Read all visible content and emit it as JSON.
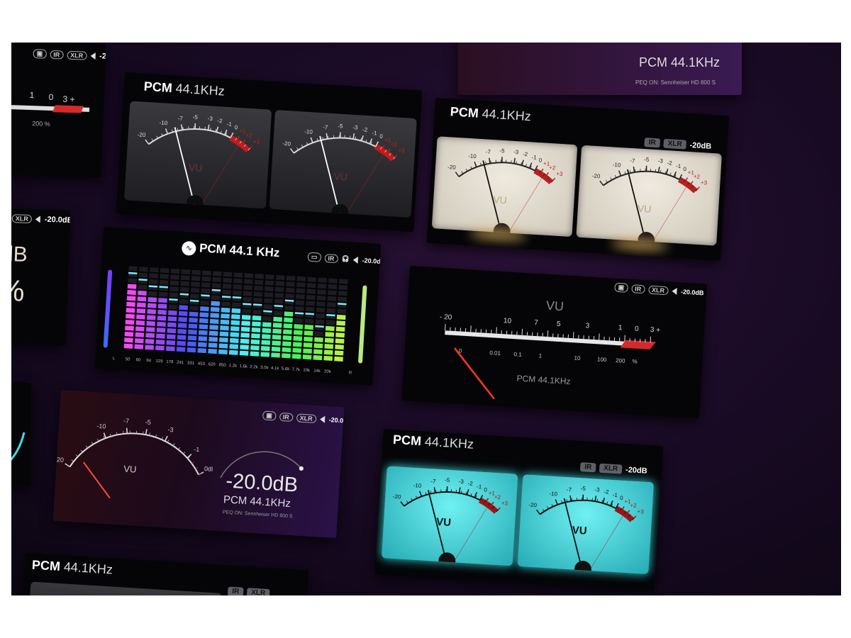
{
  "badges": {
    "ir": "IR",
    "xlr": "XLR",
    "level": "-20dB",
    "level_alt": "-20.0dB"
  },
  "format": {
    "pcm": "PCM",
    "rate": "44.1KHz",
    "rate_spaced": "44.1 KHz"
  },
  "vu": {
    "label": "VU",
    "scale": [
      "-20",
      "-10",
      "-7",
      "-5",
      "-3",
      "-2",
      "-1",
      "0",
      "+1",
      "+2",
      "+3"
    ],
    "scale_short": [
      "-20",
      "-10",
      "-7",
      "-5",
      "-3",
      "-1",
      "0dB"
    ]
  },
  "linear_meter": {
    "top": [
      "- 20",
      "10",
      "7",
      "5",
      "3",
      "1",
      "0",
      "3 +"
    ],
    "bottom": [
      "0",
      "0.01",
      "0.1",
      "1",
      "10",
      "100",
      "200",
      "%"
    ]
  },
  "spectrum": {
    "bands": [
      "L",
      "50",
      "60",
      "94",
      "129",
      "178",
      "241",
      "331",
      "453",
      "620",
      "850",
      "1.2k",
      "1.6k",
      "2.2k",
      "3.0k",
      "4.1k",
      "5.6k",
      "7.7k",
      "10k",
      "14k",
      "20k",
      "R"
    ],
    "levels": [
      0.78,
      0.72,
      0.66,
      0.62,
      0.52,
      0.56,
      0.5,
      0.55,
      0.63,
      0.58,
      0.6,
      0.48,
      0.52,
      0.42,
      0.5,
      0.54,
      0.45,
      0.4,
      0.28,
      0.44,
      0.6
    ]
  },
  "readout": {
    "db": "-20.0dB",
    "peq_label": "PEQ ON:",
    "peq_device": "Sennheiser HD 800 S"
  },
  "edge": {
    "db_fragment": "dB",
    "pct_fragment": "%",
    "scale": [
      "1",
      "0",
      "3 +"
    ],
    "pct": "200  %"
  },
  "colors": {
    "red": "#d42a2a",
    "cream": "#e8e3d8",
    "teal": "#45d8dc",
    "needle_red": "#ff3a1f"
  }
}
